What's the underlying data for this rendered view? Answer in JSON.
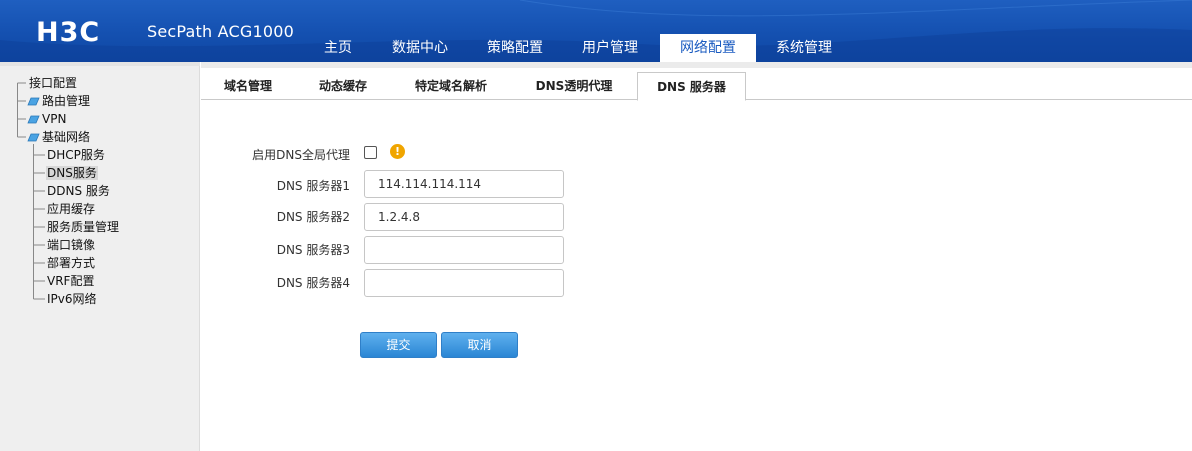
{
  "header": {
    "brand": "H3C",
    "product": "SecPath ACG1000",
    "nav": [
      {
        "label": "主页",
        "active": false
      },
      {
        "label": "数据中心",
        "active": false
      },
      {
        "label": "策略配置",
        "active": false
      },
      {
        "label": "用户管理",
        "active": false
      },
      {
        "label": "网络配置",
        "active": true
      },
      {
        "label": "系统管理",
        "active": false
      }
    ]
  },
  "sidebar": {
    "items": [
      {
        "label": "接口配置",
        "icon": "none",
        "level": 0
      },
      {
        "label": "路由管理",
        "icon": "folder-icon",
        "level": 0
      },
      {
        "label": "VPN",
        "icon": "folder-icon",
        "level": 0
      },
      {
        "label": "基础网络",
        "icon": "folder-open-icon",
        "level": 0
      },
      {
        "label": "DHCP服务",
        "icon": "none",
        "level": 1
      },
      {
        "label": "DNS服务",
        "icon": "none",
        "level": 1,
        "selected": true
      },
      {
        "label": "DDNS 服务",
        "icon": "none",
        "level": 1
      },
      {
        "label": "应用缓存",
        "icon": "none",
        "level": 1
      },
      {
        "label": "服务质量管理",
        "icon": "none",
        "level": 1
      },
      {
        "label": "端口镜像",
        "icon": "none",
        "level": 1
      },
      {
        "label": "部署方式",
        "icon": "none",
        "level": 1
      },
      {
        "label": "VRF配置",
        "icon": "none",
        "level": 1
      },
      {
        "label": "IPv6网络",
        "icon": "none",
        "level": 1
      }
    ]
  },
  "tabs": [
    {
      "label": "域名管理",
      "active": false
    },
    {
      "label": "动态缓存",
      "active": false
    },
    {
      "label": "特定域名解析",
      "active": false
    },
    {
      "label": "DNS透明代理",
      "active": false
    },
    {
      "label": "DNS 服务器",
      "active": true
    }
  ],
  "form": {
    "global_proxy_label": "启用DNS全局代理",
    "global_proxy_checked": false,
    "warn_icon": "!",
    "servers": [
      {
        "label": "DNS 服务器1",
        "value": "114.114.114.114"
      },
      {
        "label": "DNS 服务器2",
        "value": "1.2.4.8"
      },
      {
        "label": "DNS 服务器3",
        "value": ""
      },
      {
        "label": "DNS 服务器4",
        "value": ""
      }
    ],
    "submit_label": "提交",
    "cancel_label": "取消"
  },
  "colors": {
    "header_blue": "#1450b0",
    "button_blue": "#2a86d4",
    "warning": "#f0a500"
  }
}
